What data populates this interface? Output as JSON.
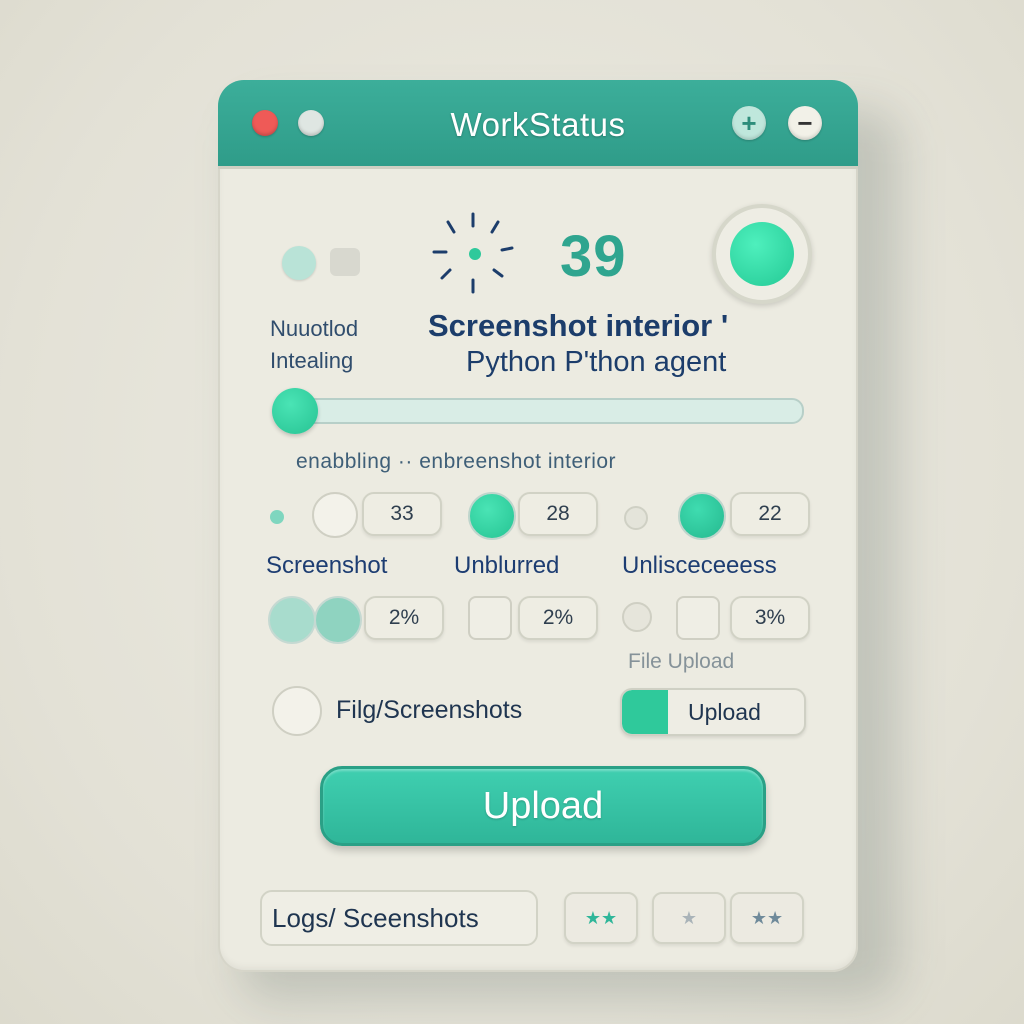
{
  "window": {
    "title": "WorkStatus",
    "controls": {
      "plus": "+",
      "minus": "−"
    }
  },
  "status": {
    "count": "39",
    "side_label_1": "Nuuotlod",
    "side_label_2": "Intealing",
    "title": "Screenshot interior '",
    "subtitle": "Python P'thon agent"
  },
  "slider": {
    "caption": "enabbling   ·· enbreenshot interior",
    "value_fraction": 0.05
  },
  "toggles_row1": [
    {
      "value": "33"
    },
    {
      "value": "28"
    },
    {
      "value": "22"
    }
  ],
  "column_labels": [
    "Screenshot",
    "Unblurred",
    "Unlisceceeess"
  ],
  "toggles_row2": [
    {
      "value": "2%"
    },
    {
      "value": "2%"
    },
    {
      "value": "3%"
    }
  ],
  "file_upload_label": "File Upload",
  "file_row": {
    "path_label": "Filg/Screenshots",
    "upload_small_label": "Upload"
  },
  "upload_button": "Upload",
  "footer": {
    "logs_label": "Logs/ Sceenshots",
    "star_buttons": [
      "★★",
      "★",
      "★★"
    ]
  },
  "colors": {
    "accent": "#2fb699",
    "titlebar": "#35a591",
    "status_green": "#2cd39f",
    "text_dark": "#1c3d6b"
  }
}
